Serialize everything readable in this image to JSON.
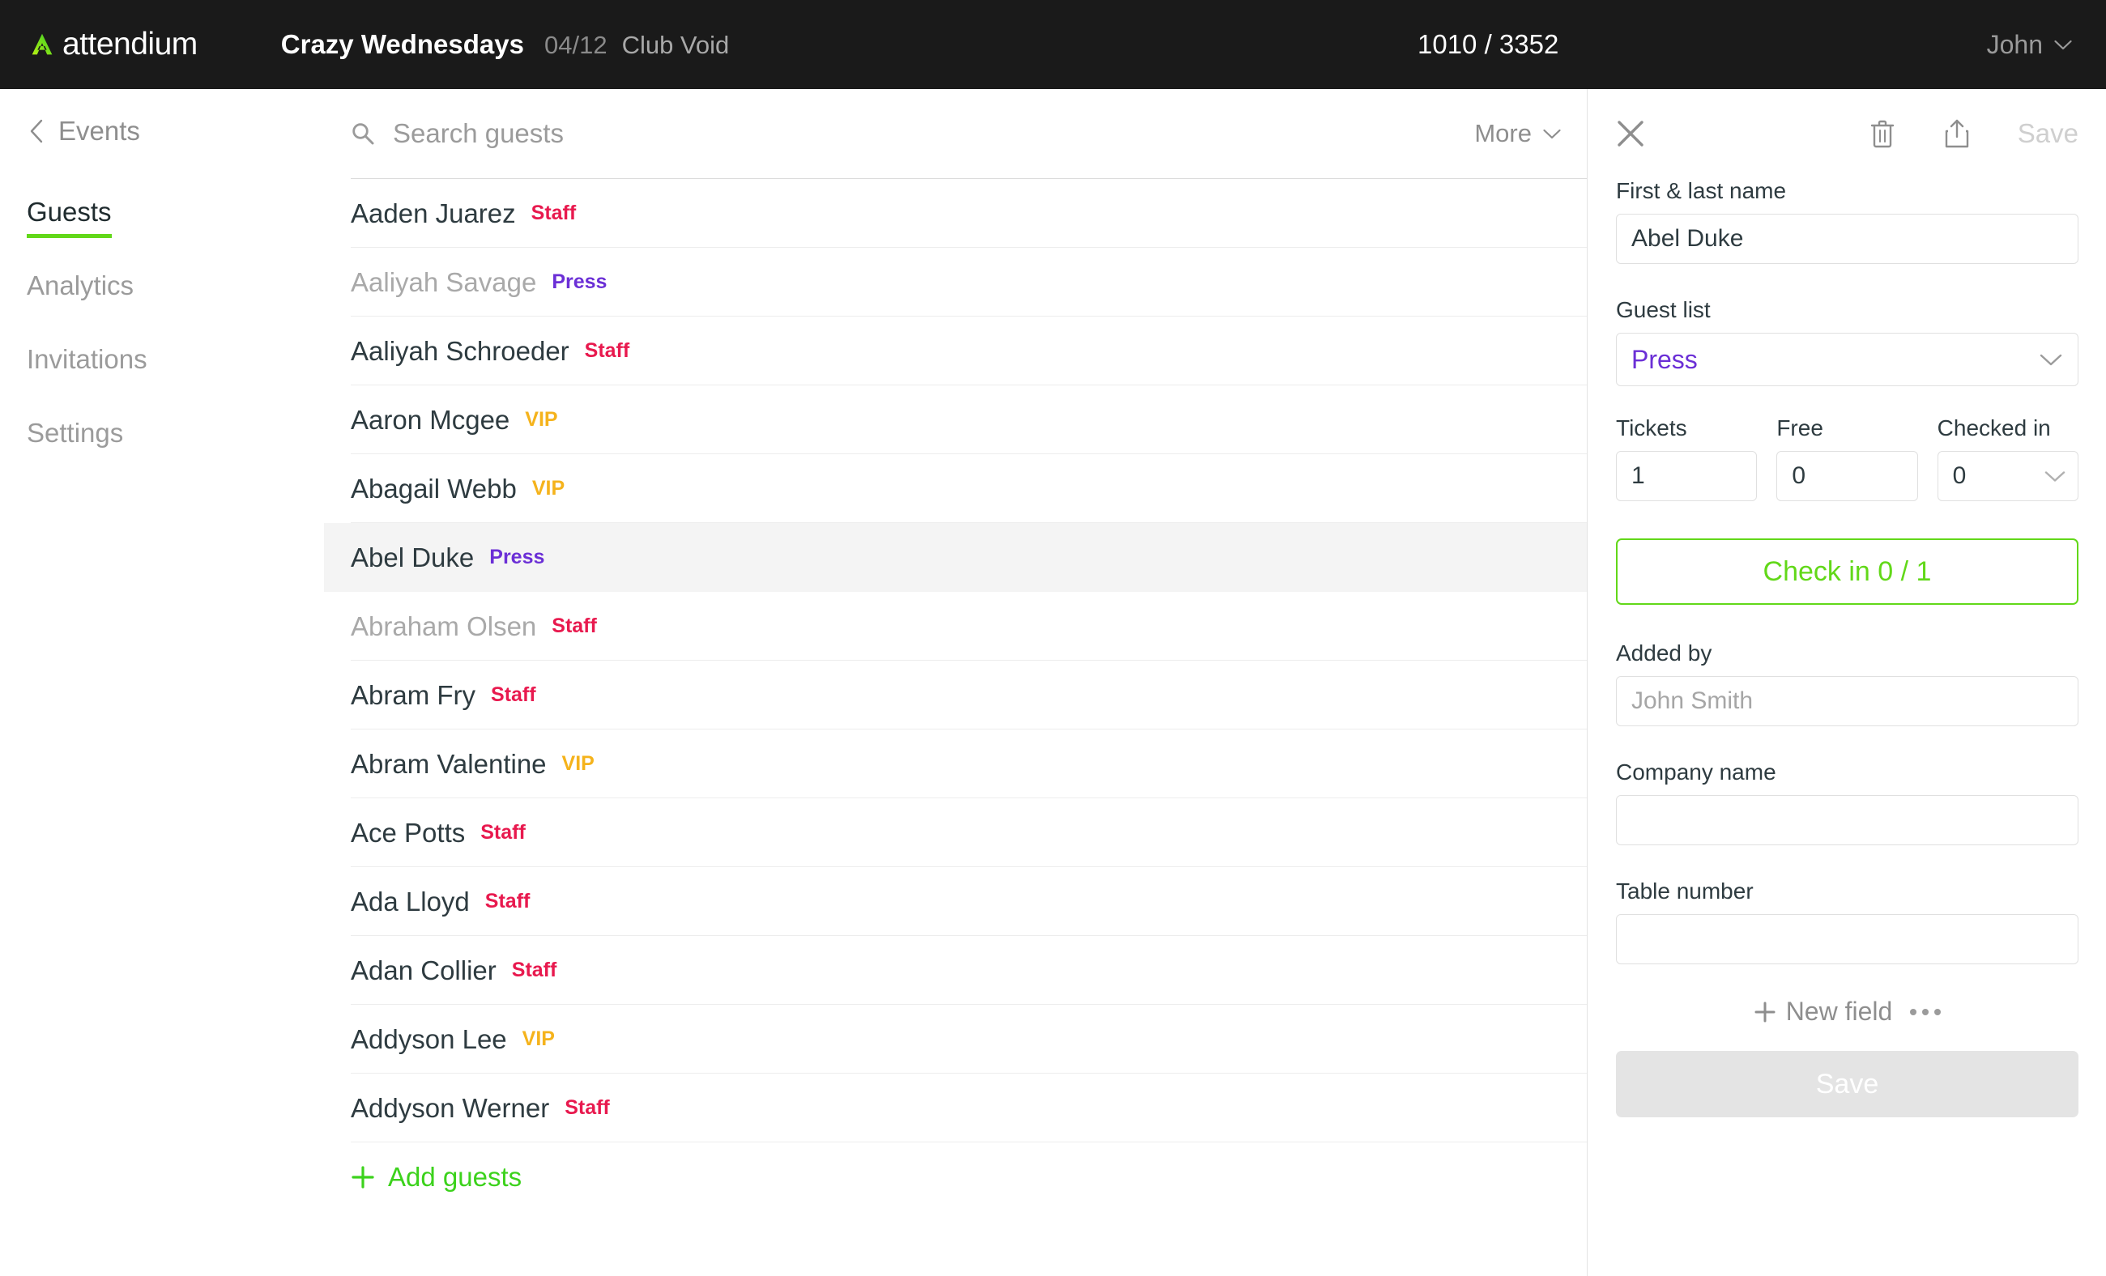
{
  "topbar": {
    "brand": "attendium",
    "event_title": "Crazy Wednesdays",
    "event_date": "04/12",
    "event_venue": "Club Void",
    "counter": "1010 / 3352",
    "user_name": "John"
  },
  "sidebar": {
    "back_label": "Events",
    "items": [
      {
        "label": "Guests",
        "active": true
      },
      {
        "label": "Analytics",
        "active": false
      },
      {
        "label": "Invitations",
        "active": false
      },
      {
        "label": "Settings",
        "active": false
      }
    ]
  },
  "list": {
    "search_placeholder": "Search guests",
    "search_value": "",
    "more_label": "More",
    "add_guests_label": "Add guests",
    "guests": [
      {
        "name": "Aaden Juarez",
        "badge": "Staff",
        "badge_type": "staff",
        "dim": false,
        "selected": false
      },
      {
        "name": "Aaliyah Savage",
        "badge": "Press",
        "badge_type": "press",
        "dim": true,
        "selected": false
      },
      {
        "name": "Aaliyah Schroeder",
        "badge": "Staff",
        "badge_type": "staff",
        "dim": false,
        "selected": false
      },
      {
        "name": "Aaron Mcgee",
        "badge": "VIP",
        "badge_type": "vip",
        "dim": false,
        "selected": false
      },
      {
        "name": "Abagail Webb",
        "badge": "VIP",
        "badge_type": "vip",
        "dim": false,
        "selected": false
      },
      {
        "name": "Abel Duke",
        "badge": "Press",
        "badge_type": "press",
        "dim": false,
        "selected": true
      },
      {
        "name": "Abraham Olsen",
        "badge": "Staff",
        "badge_type": "staff",
        "dim": true,
        "selected": false
      },
      {
        "name": "Abram Fry",
        "badge": "Staff",
        "badge_type": "staff",
        "dim": false,
        "selected": false
      },
      {
        "name": "Abram Valentine",
        "badge": "VIP",
        "badge_type": "vip",
        "dim": false,
        "selected": false
      },
      {
        "name": "Ace Potts",
        "badge": "Staff",
        "badge_type": "staff",
        "dim": false,
        "selected": false
      },
      {
        "name": "Ada Lloyd",
        "badge": "Staff",
        "badge_type": "staff",
        "dim": false,
        "selected": false
      },
      {
        "name": "Adan Collier",
        "badge": "Staff",
        "badge_type": "staff",
        "dim": false,
        "selected": false
      },
      {
        "name": "Addyson Lee",
        "badge": "VIP",
        "badge_type": "vip",
        "dim": false,
        "selected": false
      },
      {
        "name": "Addyson Werner",
        "badge": "Staff",
        "badge_type": "staff",
        "dim": false,
        "selected": false
      }
    ]
  },
  "panel": {
    "header_save_label": "Save",
    "name_label": "First & last name",
    "name_value": "Abel Duke",
    "name_placeholder": "",
    "guestlist_label": "Guest list",
    "guestlist_value": "Press",
    "tickets_label": "Tickets",
    "tickets_value": "1",
    "free_label": "Free",
    "free_value": "0",
    "checkedin_label": "Checked in",
    "checkedin_value": "0",
    "checkin_button": "Check in 0 / 1",
    "addedby_label": "Added by",
    "addedby_value": "",
    "addedby_placeholder": "John Smith",
    "company_label": "Company name",
    "company_value": "",
    "company_placeholder": "",
    "table_label": "Table number",
    "table_value": "",
    "table_placeholder": "",
    "newfield_label": "New field",
    "save_label": "Save"
  },
  "colors": {
    "brand_green": "#62d819",
    "add_green": "#3cd21c",
    "staff": "#e8194e",
    "press": "#6b2fd6",
    "vip": "#f5b31c",
    "topbar_bg": "#1a1a1a",
    "selected_row": "#f4f4f4"
  }
}
